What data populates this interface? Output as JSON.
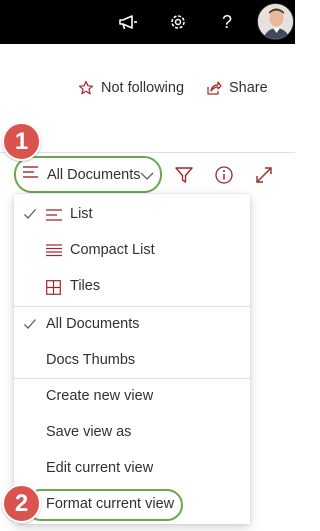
{
  "suite_bar": {
    "icons": [
      "megaphone-icon",
      "gear-icon",
      "help-icon"
    ],
    "help_glyph": "?"
  },
  "header": {
    "follow_label": "Not following",
    "share_label": "Share"
  },
  "command_bar": {
    "view_label": "All Documents",
    "icons": [
      "filter-icon",
      "info-icon",
      "expand-icon"
    ]
  },
  "callouts": {
    "first": "1",
    "second": "2"
  },
  "view_menu": {
    "layout_items": [
      {
        "label": "List",
        "checked": true,
        "icon": "list-icon"
      },
      {
        "label": "Compact List",
        "checked": false,
        "icon": "compact-list-icon"
      },
      {
        "label": "Tiles",
        "checked": false,
        "icon": "tiles-icon"
      }
    ],
    "views": [
      {
        "label": "All Documents",
        "checked": true
      },
      {
        "label": "Docs Thumbs",
        "checked": false
      }
    ],
    "actions": [
      {
        "label": "Create new view"
      },
      {
        "label": "Save view as"
      },
      {
        "label": "Edit current view"
      },
      {
        "label": "Format current view"
      }
    ]
  },
  "colors": {
    "suite_bar": "#000000",
    "accent": "#a4262c",
    "highlight_outline": "#6aa84f",
    "callout": "#d9534f"
  }
}
